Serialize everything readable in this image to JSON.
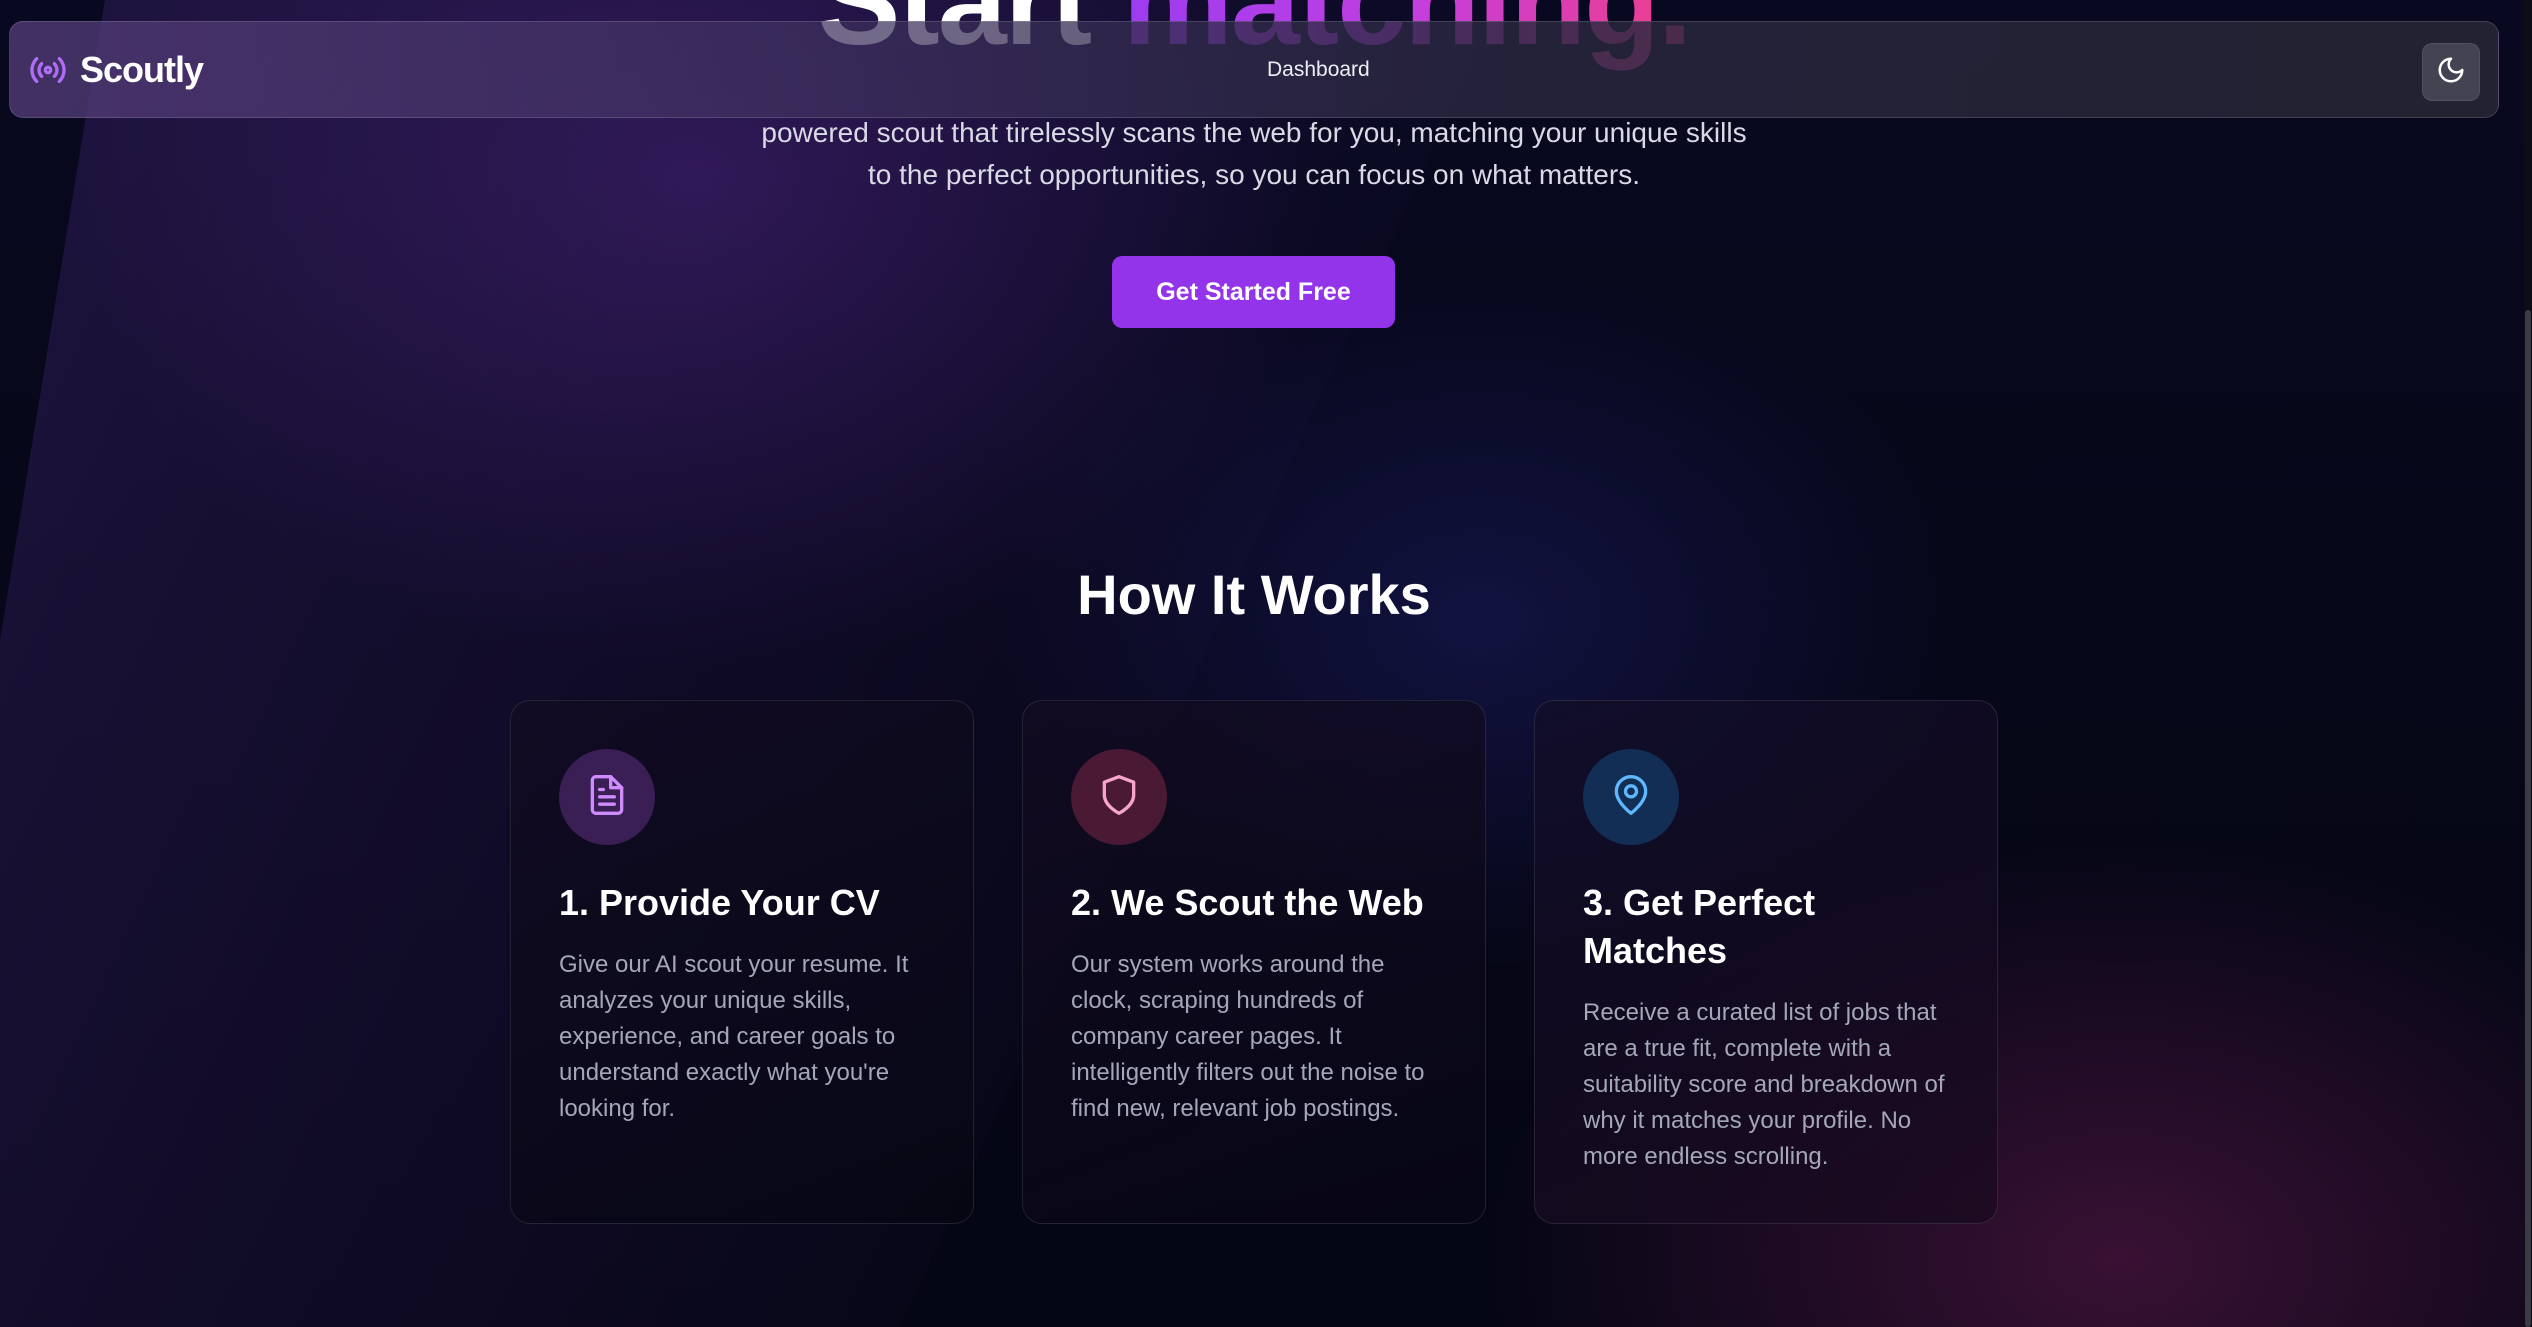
{
  "navbar": {
    "brand": "Scoutly",
    "brand_icon": "radio-signal-icon",
    "nav_dashboard": "Dashboard",
    "theme_toggle_icon": "moon-icon"
  },
  "hero": {
    "title_plain": "Start",
    "title_accent": "matching.",
    "description": "powered scout that tirelessly scans the web for you, matching your unique skills to the perfect opportunities, so you can focus on what matters.",
    "cta_label": "Get Started Free"
  },
  "how_it_works": {
    "title": "How It Works",
    "cards": [
      {
        "title": "1. Provide Your CV",
        "body": "Give our AI scout your resume. It analyzes your unique skills, experience, and career goals to understand exactly what you're looking for.",
        "icon": "document-icon",
        "icon_color": "#d08cff",
        "icon_bg": "#3a1f55"
      },
      {
        "title": "2. We Scout the Web",
        "body": "Our system works around the clock, scraping hundreds of company career pages. It intelligently filters out the noise to find new, relevant job postings.",
        "icon": "shield-icon",
        "icon_color": "#f7a6c9",
        "icon_bg": "#4a1a34"
      },
      {
        "title": "3. Get Perfect Matches",
        "body": "Receive a curated list of jobs that are a true fit, complete with a suitability score and breakdown of why it matches your profile. No more endless scrolling.",
        "icon": "map-pin-icon",
        "icon_color": "#5fb8ff",
        "icon_bg": "#132e55"
      }
    ]
  },
  "colors": {
    "accent_purple": "#9333ea",
    "accent_pink": "#ef3f8a",
    "background": "#050614"
  }
}
